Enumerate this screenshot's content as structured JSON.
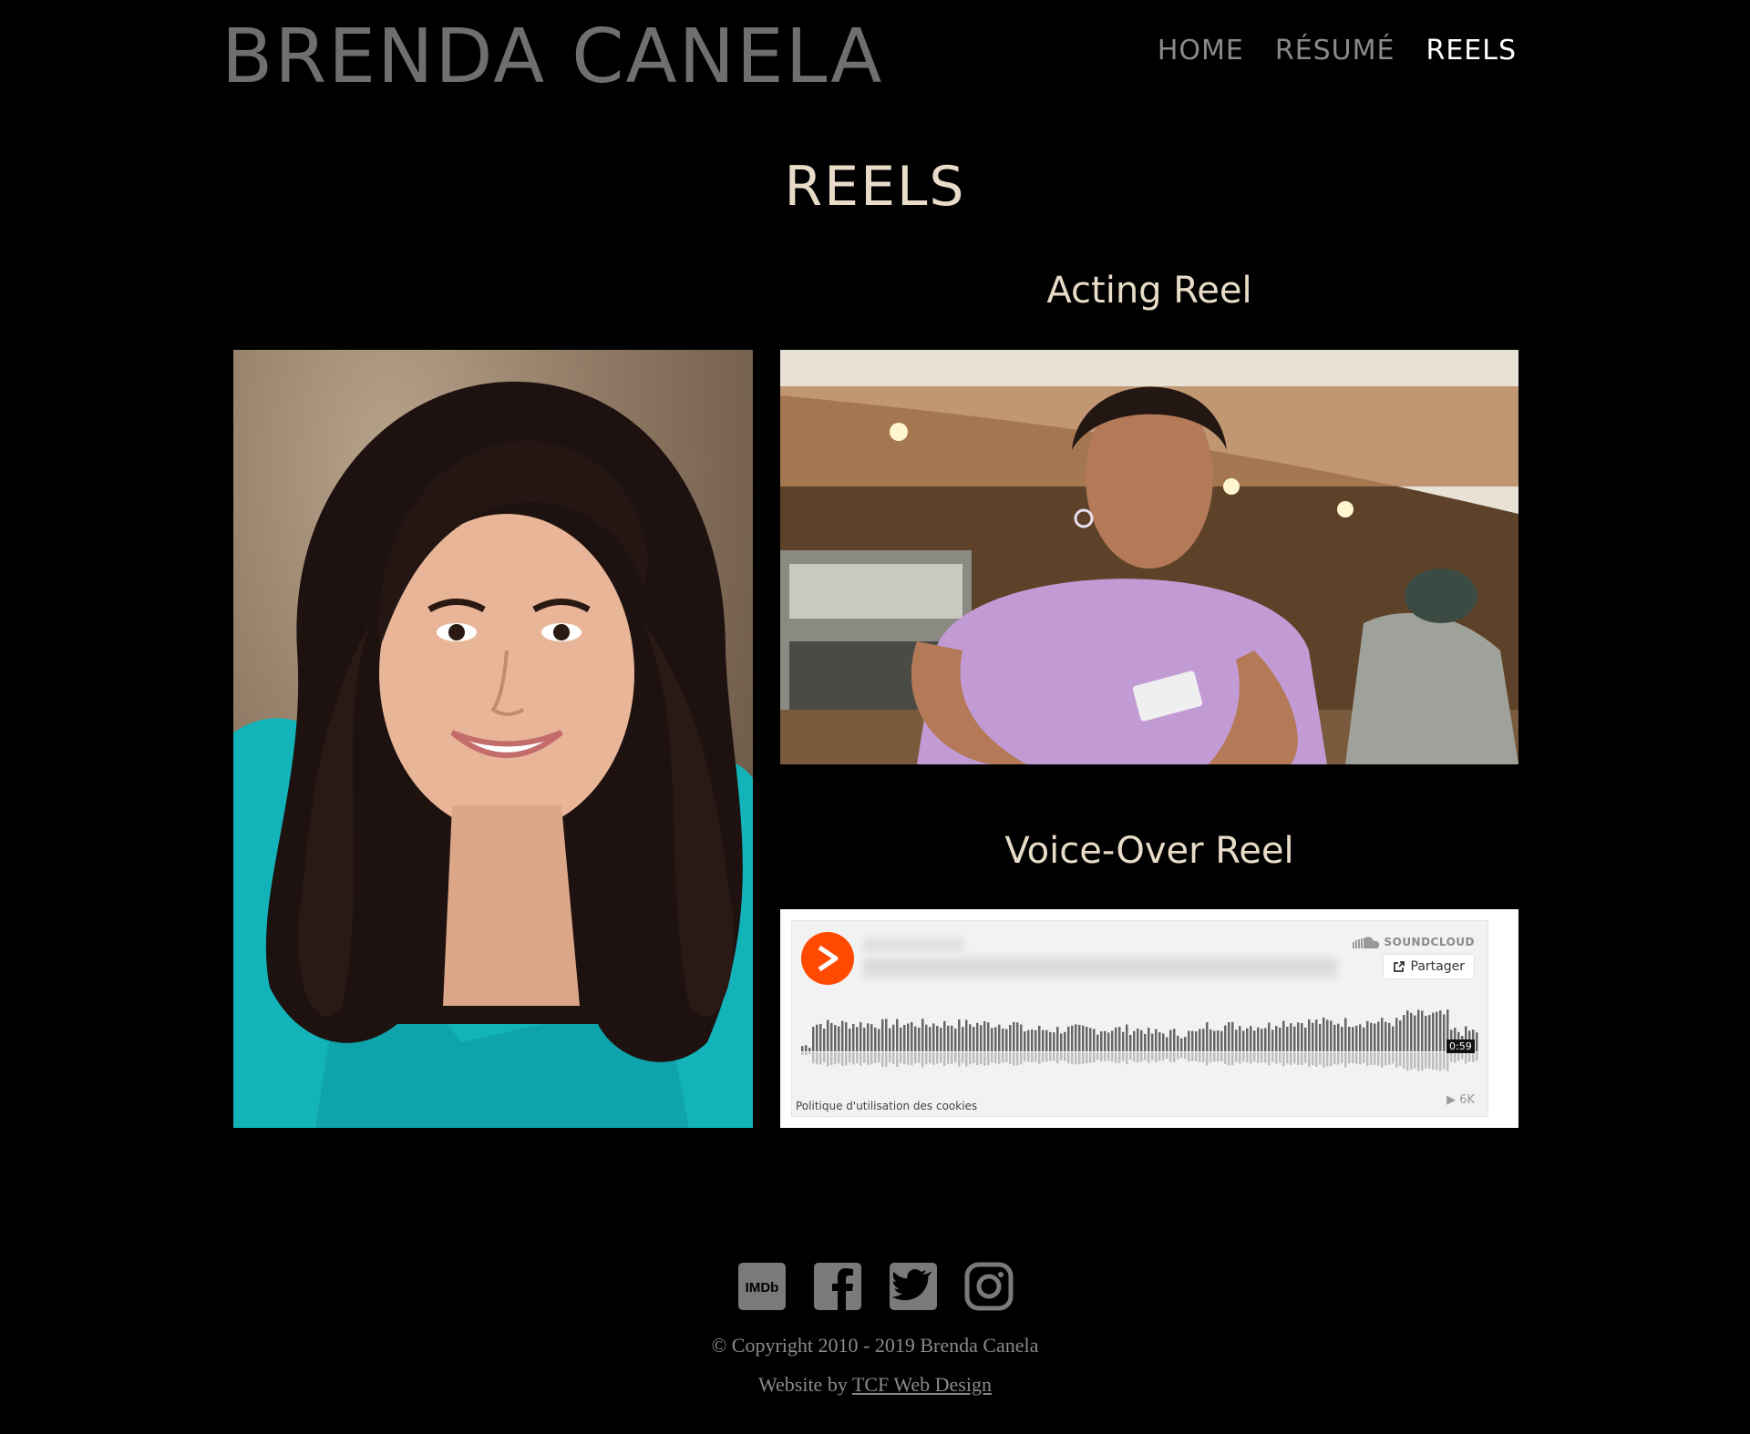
{
  "header": {
    "site_title": "BRENDA CANELA",
    "nav": [
      {
        "label": "HOME"
      },
      {
        "label": "RÉSUMÉ"
      },
      {
        "label": "REELS"
      }
    ]
  },
  "main": {
    "page_heading": "REELS",
    "acting_heading": "Acting Reel",
    "voice_heading": "Voice-Over Reel",
    "soundcloud": {
      "brand": "SOUNDCLOUD",
      "share_label": "Partager",
      "duration": "0:59",
      "cookie_policy": "Politique d'utilisation des cookies",
      "plays": "6K"
    }
  },
  "footer": {
    "social_icons": [
      "imdb-icon",
      "facebook-icon",
      "twitter-icon",
      "instagram-icon"
    ],
    "copyright": "© Copyright 2010 - 2019 Brenda Canela",
    "credit_prefix": "Website by",
    "credit_link": "TCF Web Design"
  },
  "colors": {
    "background": "#000000",
    "heading": "#e8dcc8",
    "nav_active": "#ffffff",
    "nav_inactive": "#8a8a8a",
    "soundcloud_orange": "#ff4a00"
  }
}
